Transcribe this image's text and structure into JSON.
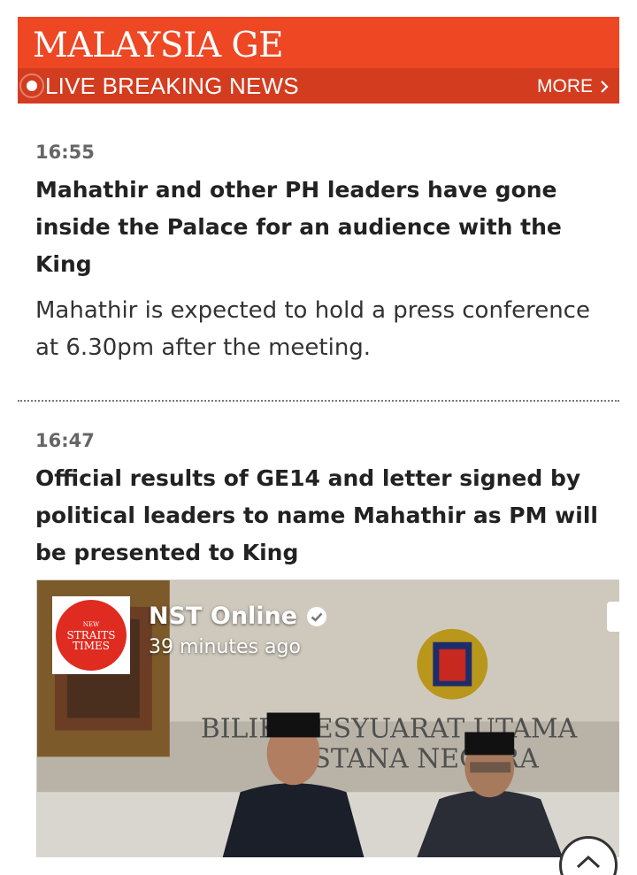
{
  "banner": {
    "title": "MALAYSIA GE",
    "live_label": "LIVE BREAKING NEWS",
    "more_label": "MORE"
  },
  "entries": [
    {
      "time": "16:55",
      "headline": "Mahathir and other PH leaders have gone inside the Palace for an audience with the King",
      "body": "Mahathir is expected to hold a press conference at 6.30pm after the meeting."
    },
    {
      "time": "16:47",
      "headline": "Official results of GE14 and letter signed by political leaders to name Mahathir as PM will be presented to King"
    }
  ],
  "embed": {
    "page_name": "NST Online",
    "post_time": "39 minutes ago",
    "avatar_lines": [
      "NEW",
      "STRAITS",
      "TIMES"
    ],
    "scene_text_line1": "BILIK MESYUARAT UTAMA",
    "scene_text_line2": "ISTANA NEGARA"
  },
  "colors": {
    "banner": "#ee4724",
    "banner_bar": "#d43c1f"
  }
}
